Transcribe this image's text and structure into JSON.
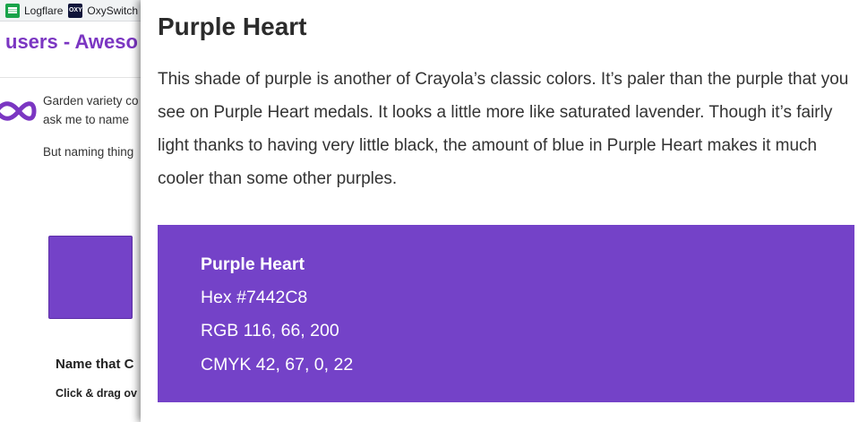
{
  "bookmarks": [
    {
      "label": "Logflare",
      "icon": "logflare-icon"
    },
    {
      "label": "OxySwitch",
      "icon": "oxyswitch-icon"
    }
  ],
  "background_page": {
    "heading": "users - Aweso",
    "paragraph_line1": "Garden variety co",
    "paragraph_line2": "ask me to name",
    "paragraph_line3": "But naming thing",
    "swatch_color": "#7442C8",
    "name_heading": "Name that C",
    "drag_hint": "Click & drag ov"
  },
  "popup": {
    "title": "Purple Heart",
    "description": "This shade of purple is another of Crayola’s classic colors. It’s paler than the purple that you see on Purple Heart medals. It looks a little more like saturated lavender. Though it’s fairly light thanks to having very little black, the amount of blue in Purple Heart makes it much cooler than some other purples.",
    "card": {
      "background": "#7442C8",
      "name": "Purple Heart",
      "hex": "Hex #7442C8",
      "rgb": "RGB 116, 66, 200",
      "cmyk": "CMYK 42, 67, 0, 22"
    }
  }
}
